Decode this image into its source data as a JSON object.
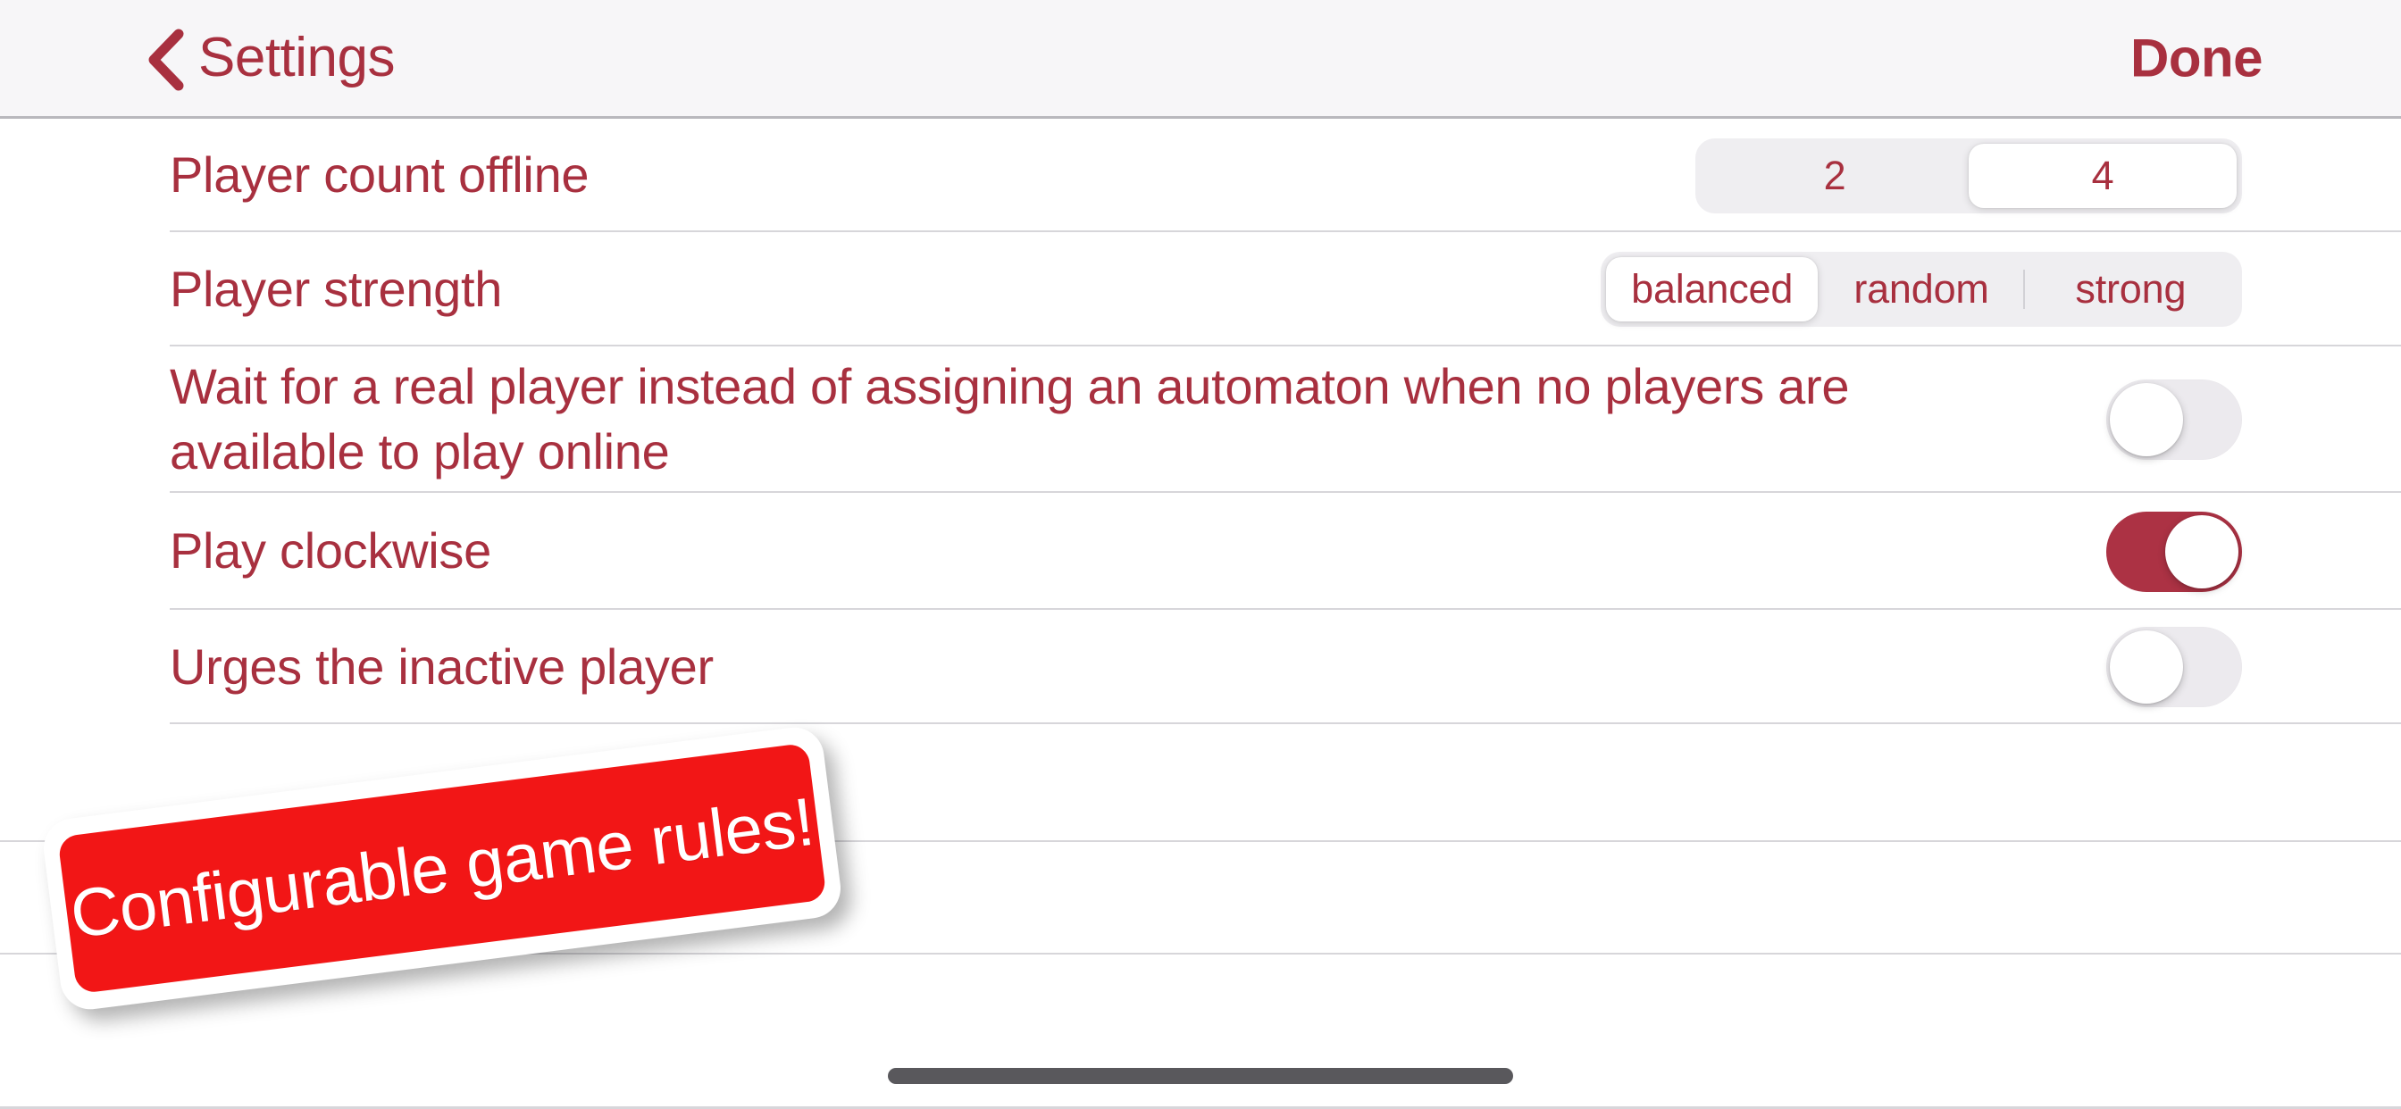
{
  "header": {
    "back_icon": "chevron-left-icon",
    "back_label": "Settings",
    "done_label": "Done"
  },
  "settings": {
    "rows": [
      {
        "label": "Player count offline",
        "control": "segmented",
        "options": [
          "2",
          "4"
        ],
        "selected": "4"
      },
      {
        "label": "Player strength",
        "control": "segmented",
        "options": [
          "balanced",
          "random",
          "strong"
        ],
        "selected": "balanced"
      },
      {
        "label": "Wait for a real player instead of assigning an automaton when no players are available to play online",
        "control": "switch",
        "value": "off"
      },
      {
        "label": "Play clockwise",
        "control": "switch",
        "value": "on"
      },
      {
        "label": "Urges the inactive player",
        "control": "switch",
        "value": "off"
      }
    ]
  },
  "sticker": {
    "text": "Configurable game rules!",
    "background": "#f21616",
    "text_color": "#ffffff"
  },
  "colors": {
    "accent": "#a8303f",
    "switch_on": "#ac3244",
    "track": "#efeef1",
    "divider": "#d7d6da",
    "navbar_bg": "#f7f6f8"
  },
  "home_indicator": "home-indicator"
}
